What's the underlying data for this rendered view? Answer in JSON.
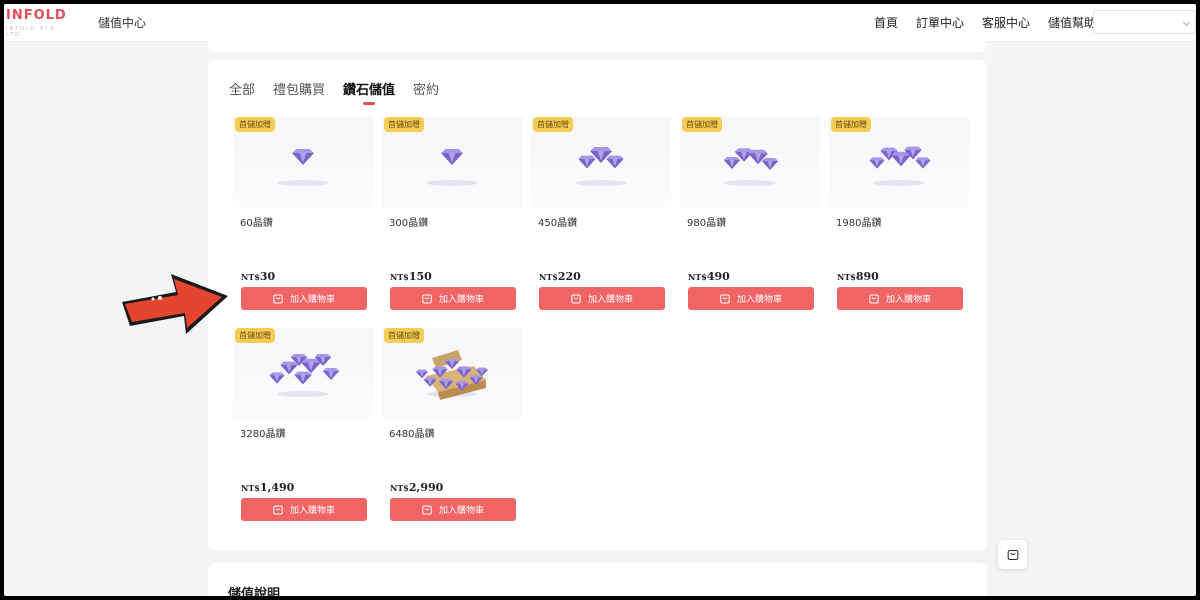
{
  "header": {
    "logo_text": "INFOLD",
    "logo_sub": "INFOLD PTE. LTD.",
    "site_title": "儲值中心",
    "nav": [
      "首頁",
      "訂單中心",
      "客服中心",
      "儲值幫助"
    ],
    "language_select_value": ""
  },
  "tabs": {
    "items": [
      "全部",
      "禮包購買",
      "鑽石儲值",
      "密約"
    ],
    "active": "鑽石儲值"
  },
  "products": [
    {
      "badge": "首儲加贈",
      "name": "60晶鑽",
      "currency": "NT$",
      "price": "30",
      "button": "加入購物車"
    },
    {
      "badge": "首儲加贈",
      "name": "300晶鑽",
      "currency": "NT$",
      "price": "150",
      "button": "加入購物車"
    },
    {
      "badge": "首儲加贈",
      "name": "450晶鑽",
      "currency": "NT$",
      "price": "220",
      "button": "加入購物車"
    },
    {
      "badge": "首儲加贈",
      "name": "980晶鑽",
      "currency": "NT$",
      "price": "490",
      "button": "加入購物車"
    },
    {
      "badge": "首儲加贈",
      "name": "1980晶鑽",
      "currency": "NT$",
      "price": "890",
      "button": "加入購物車"
    },
    {
      "badge": "首儲加贈",
      "name": "3280晶鑽",
      "currency": "NT$",
      "price": "1,490",
      "button": "加入購物車"
    },
    {
      "badge": "首儲加贈",
      "name": "6480晶鑽",
      "currency": "NT$",
      "price": "2,990",
      "button": "加入購物車"
    }
  ],
  "next_section_title": "儲值說明",
  "colors": {
    "accent": "#f06466",
    "badge": "#f5cd55",
    "gem": "#7a63c9",
    "arrow": "#e5452f"
  }
}
